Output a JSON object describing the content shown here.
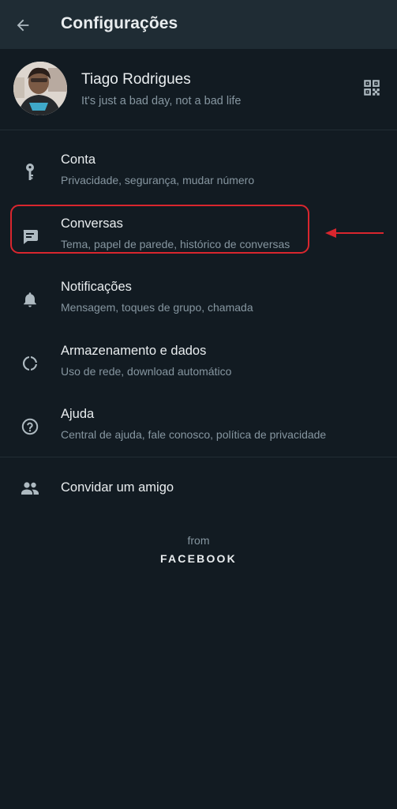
{
  "header": {
    "title": "Configurações",
    "back_icon": "arrow-left-icon"
  },
  "profile": {
    "name": "Tiago Rodrigues",
    "status": "It's just a bad day, not a bad life",
    "qr_icon": "qr-code-icon"
  },
  "settings": [
    {
      "title": "Conta",
      "subtitle": "Privacidade, segurança, mudar número",
      "icon": "key-icon"
    },
    {
      "title": "Conversas",
      "subtitle": "Tema, papel de parede, histórico de conversas",
      "icon": "chat-icon"
    },
    {
      "title": "Notificações",
      "subtitle": "Mensagem, toques de grupo, chamada",
      "icon": "bell-icon"
    },
    {
      "title": "Armazenamento e dados",
      "subtitle": "Uso de rede, download automático",
      "icon": "storage-ring-icon"
    },
    {
      "title": "Ajuda",
      "subtitle": "Central de ajuda, fale conosco, política de privacidade",
      "icon": "help-circle-icon"
    }
  ],
  "invite": {
    "title": "Convidar um amigo",
    "icon": "people-icon"
  },
  "footer": {
    "from": "from",
    "brand": "FACEBOOK"
  },
  "colors": {
    "background": "#121b22",
    "header": "#1f2c34",
    "primary_text": "#e9edef",
    "secondary_text": "#8696a0",
    "icon": "#aebac1",
    "annotation": "#d9262e"
  }
}
